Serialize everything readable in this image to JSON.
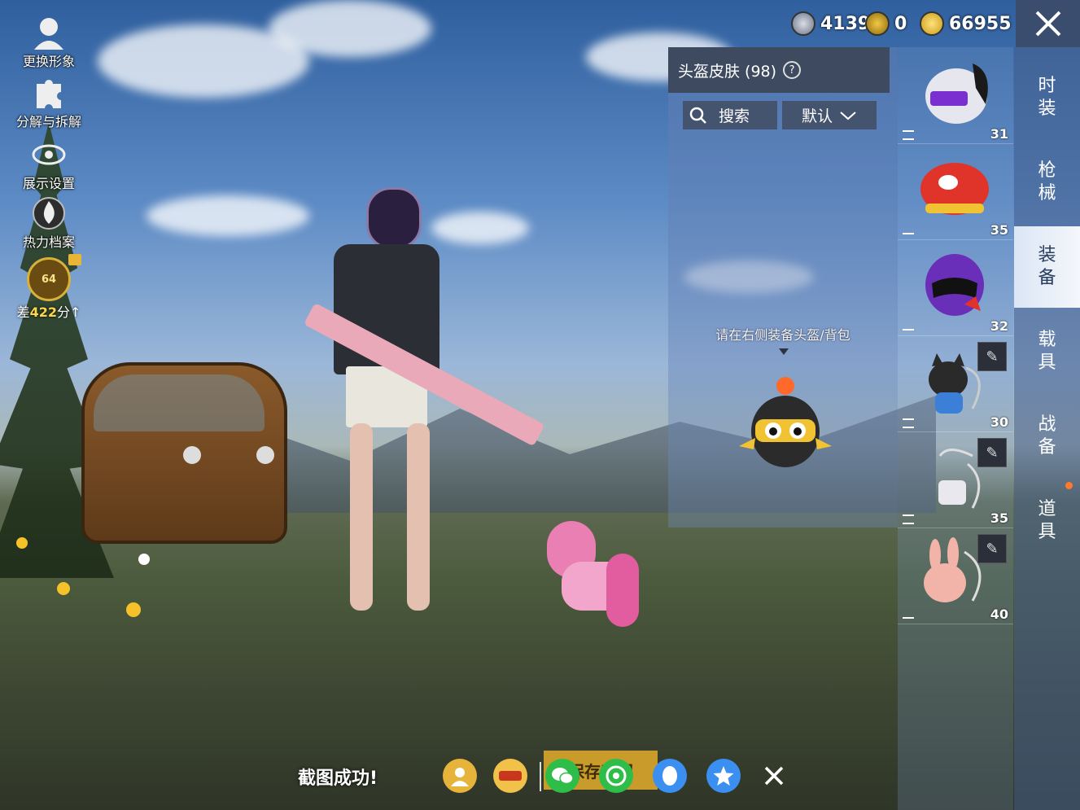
{
  "left_menu": {
    "change_avatar": "更换形象",
    "decompose": "分解与拆解",
    "display_settings": "展示设置",
    "heat_archive": "热力档案",
    "rank_level": "64",
    "rank_prefix": "差",
    "rank_points": "422",
    "rank_suffix": "分↑"
  },
  "currency": {
    "silver": "4139",
    "gold_token": "0",
    "bp": "66955"
  },
  "panel": {
    "title": "头盔皮肤 (98)",
    "help": "?",
    "search_label": "搜索",
    "sort_label": "默认",
    "hint": "请在右侧装备头盔/背包"
  },
  "items": [
    {
      "count": "31",
      "icon": "helmet-cyber"
    },
    {
      "count": "35",
      "icon": "helmet-red-fish"
    },
    {
      "count": "32",
      "icon": "helmet-purple-moto"
    },
    {
      "count": "30",
      "icon": "backpack-black-cat"
    },
    {
      "count": "35",
      "icon": "backpack-white"
    },
    {
      "count": "40",
      "icon": "backpack-pink-bunny"
    }
  ],
  "tabs": [
    {
      "label": "时装"
    },
    {
      "label": "枪械"
    },
    {
      "label": "装备"
    },
    {
      "label": "载具"
    },
    {
      "label": "战备"
    },
    {
      "label": "道具"
    }
  ],
  "bottom": {
    "toast": "截图成功!",
    "save_label": "保存截图"
  },
  "colors": {
    "tab_active_bg": "#eef3fa",
    "save_btn": "#c89b2a",
    "notify_dot": "#ff7a2a"
  }
}
